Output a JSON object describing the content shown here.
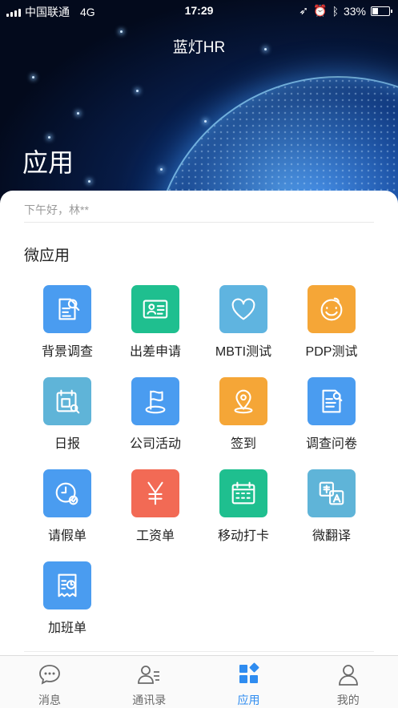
{
  "status_bar": {
    "carrier": "中国联通",
    "network": "4G",
    "time": "17:29",
    "battery": "33%",
    "battery_level": 0.33
  },
  "header": {
    "title": "蓝灯HR",
    "heading": "应用"
  },
  "greeting": "下午好，林**",
  "section_title": "微应用",
  "apps": [
    {
      "label": "背景调查",
      "icon": "document-search-icon",
      "color": "#4a9cf0"
    },
    {
      "label": "出差申请",
      "icon": "id-card-icon",
      "color": "#1fbf8f"
    },
    {
      "label": "MBTI测试",
      "icon": "heart-icon",
      "color": "#5fb4e0"
    },
    {
      "label": "PDP测试",
      "icon": "smiley-icon",
      "color": "#f5a637"
    },
    {
      "label": "日报",
      "icon": "calendar-search-icon",
      "color": "#5fb4d8"
    },
    {
      "label": "公司活动",
      "icon": "flag-icon",
      "color": "#4a9cf0"
    },
    {
      "label": "签到",
      "icon": "location-pin-icon",
      "color": "#f5a637"
    },
    {
      "label": "调查问卷",
      "icon": "questionnaire-icon",
      "color": "#4a9cf0"
    },
    {
      "label": "请假单",
      "icon": "clock-check-icon",
      "color": "#4a9cf0"
    },
    {
      "label": "工资单",
      "icon": "yen-icon",
      "color": "#f26a55"
    },
    {
      "label": "移动打卡",
      "icon": "calendar-grid-icon",
      "color": "#1fbf8f"
    },
    {
      "label": "微翻译",
      "icon": "translate-icon",
      "color": "#5fb4d8"
    },
    {
      "label": "加班单",
      "icon": "overtime-receipt-icon",
      "color": "#4a9cf0"
    }
  ],
  "tabs": [
    {
      "label": "消息",
      "icon": "chat-bubble-icon",
      "active": false
    },
    {
      "label": "通讯录",
      "icon": "contacts-icon",
      "active": false
    },
    {
      "label": "应用",
      "icon": "apps-grid-icon",
      "active": true
    },
    {
      "label": "我的",
      "icon": "person-icon",
      "active": false
    }
  ],
  "colors": {
    "accent": "#2f8cf0",
    "tab_inactive": "#6a6a6a"
  }
}
